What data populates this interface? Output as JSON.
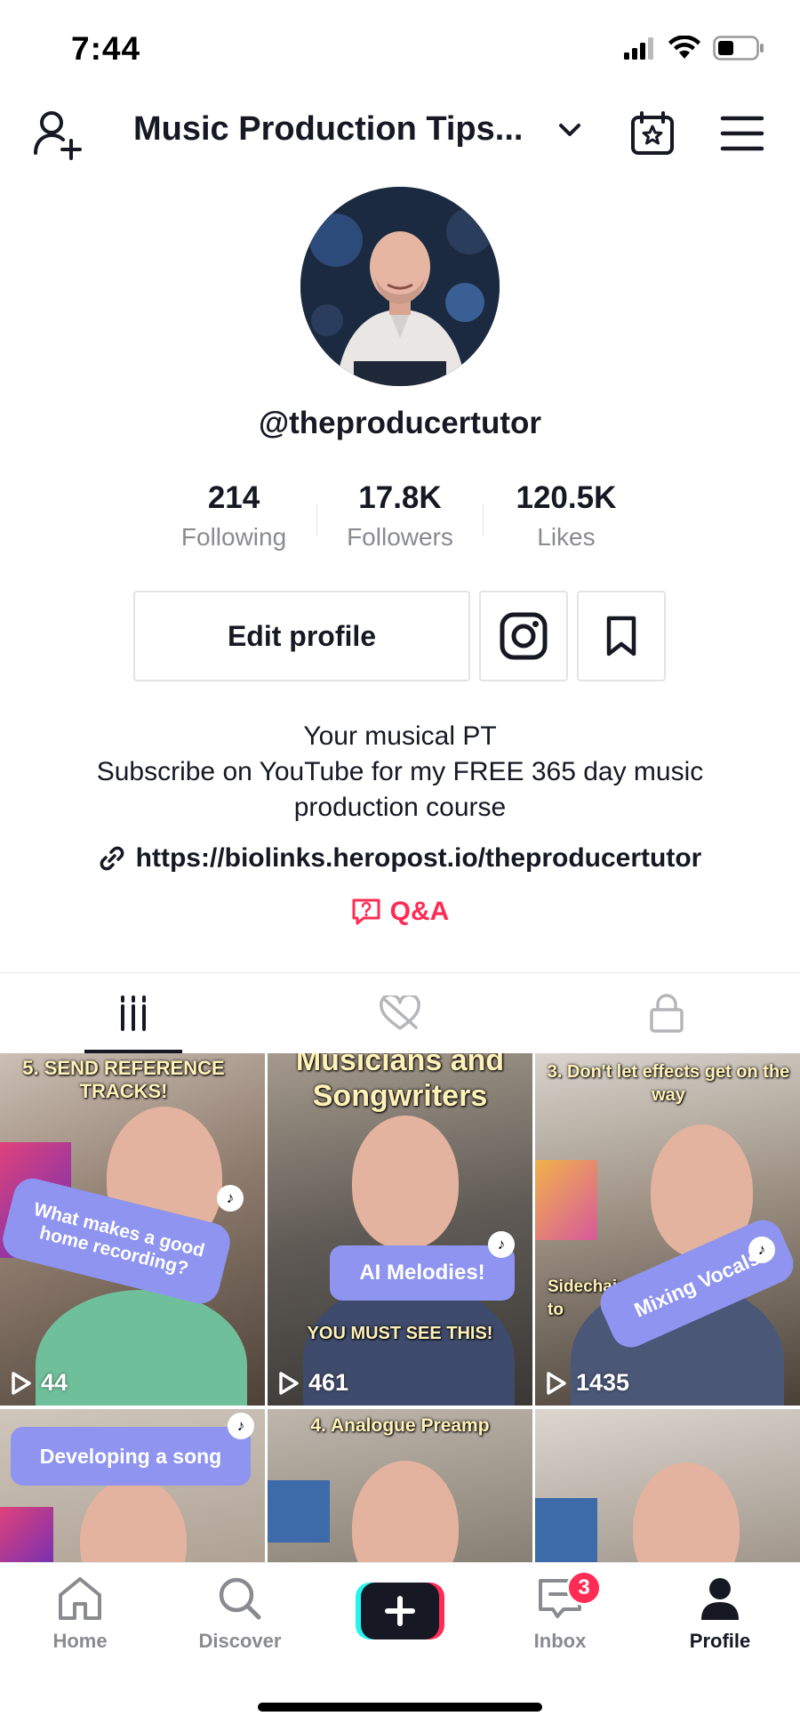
{
  "status_bar": {
    "time": "7:44",
    "icons": [
      "signal-icon",
      "wifi-icon",
      "battery-icon"
    ]
  },
  "header": {
    "title": "Music Production Tips...",
    "icons": [
      "add-user-icon",
      "chevron-down-icon",
      "calendar-star-icon",
      "hamburger-menu-icon"
    ]
  },
  "profile": {
    "handle": "@theproducertutor",
    "stats": [
      {
        "value": "214",
        "label": "Following"
      },
      {
        "value": "17.8K",
        "label": "Followers"
      },
      {
        "value": "120.5K",
        "label": "Likes"
      }
    ],
    "edit_label": "Edit profile",
    "bio_lines": [
      "Your musical PT",
      "Subscribe on YouTube for my FREE 365 day music",
      "production course"
    ],
    "link": "https://biolinks.heropost.io/theproducertutor",
    "qa_label": "Q&A"
  },
  "tabs": [
    {
      "name": "videos",
      "icon": "grid-bars-icon",
      "active": true
    },
    {
      "name": "liked",
      "icon": "hidden-heart-icon",
      "active": false
    },
    {
      "name": "private",
      "icon": "lock-icon",
      "active": false
    }
  ],
  "videos": [
    {
      "top_caption": "5. SEND REFERENCE TRACKS!",
      "pill": "What makes a good home recording?",
      "views": "44"
    },
    {
      "top_caption": "Musicians and Songwriters",
      "pill": "AI Melodies!",
      "overlay": "YOU MUST SEE THIS!",
      "views": "461"
    },
    {
      "top_caption": "3. Don't let effects get on the way",
      "pill": "Mixing Vocals",
      "overlay": "Sidechain co effects to",
      "views": "1435"
    },
    {
      "pill": "Developing a song"
    },
    {
      "top_caption": "4. Analogue Preamp"
    },
    {}
  ],
  "bottom_nav": [
    {
      "label": "Home",
      "icon": "home-icon"
    },
    {
      "label": "Discover",
      "icon": "search-icon"
    },
    {
      "label": "",
      "icon": "plus-icon"
    },
    {
      "label": "Inbox",
      "icon": "inbox-icon",
      "badge": "3"
    },
    {
      "label": "Profile",
      "icon": "profile-icon",
      "active": true
    }
  ],
  "colors": {
    "accent": "#fe2c55",
    "text": "#161823",
    "muted": "#8a8b91",
    "pill": "#8e94ef",
    "caption": "#fff2b8"
  }
}
